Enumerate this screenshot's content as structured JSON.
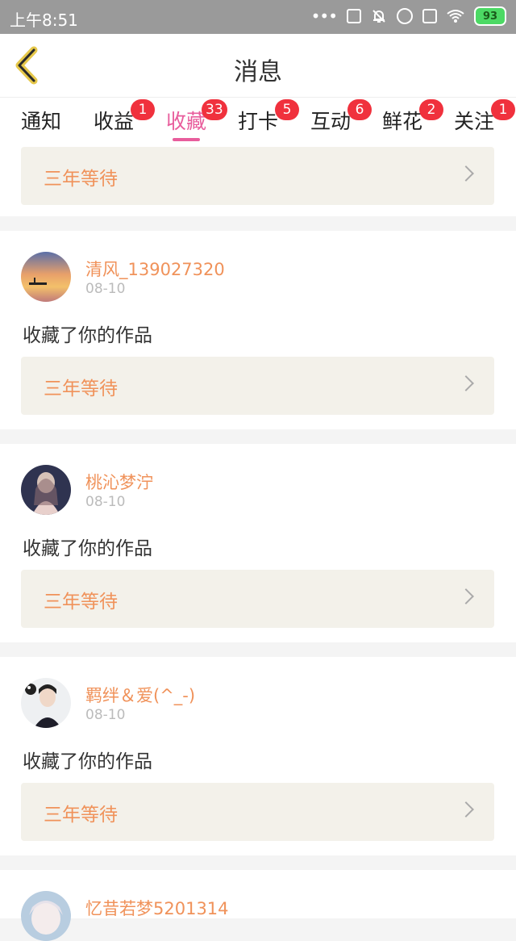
{
  "status_bar": {
    "time": "上午8:51",
    "battery": "93",
    "icons": [
      "more-dots-icon",
      "copy-icon",
      "bell-off-icon",
      "alarm-icon",
      "sim-off-icon",
      "wifi-icon",
      "battery-icon"
    ]
  },
  "header": {
    "title": "消息",
    "back_icon": "chevron-left-icon"
  },
  "tabs": [
    {
      "label": "通知",
      "badge": ""
    },
    {
      "label": "收益",
      "badge": "1"
    },
    {
      "label": "收藏",
      "badge": "33"
    },
    {
      "label": "打卡",
      "badge": "5"
    },
    {
      "label": "互动",
      "badge": "6"
    },
    {
      "label": "鲜花",
      "badge": "2"
    },
    {
      "label": "关注",
      "badge": "1"
    }
  ],
  "active_tab": "收藏",
  "colors": {
    "accent": "#e85d9c",
    "badge": "#f0313d",
    "name": "#f0925a",
    "work_bg": "#f3f1ea"
  },
  "top_partial_card": {
    "work_title": "三年等待"
  },
  "items": [
    {
      "user": "清风_139027320",
      "date": "08-10",
      "message": "收藏了你的作品",
      "work_title": "三年等待"
    },
    {
      "user": "桃沁梦泞",
      "date": "08-10",
      "message": "收藏了你的作品",
      "work_title": "三年等待"
    },
    {
      "user": "羁绊＆爱(^_-)",
      "date": "08-10",
      "message": "收藏了你的作品",
      "work_title": "三年等待"
    },
    {
      "user": "忆昔若梦5201314"
    }
  ]
}
